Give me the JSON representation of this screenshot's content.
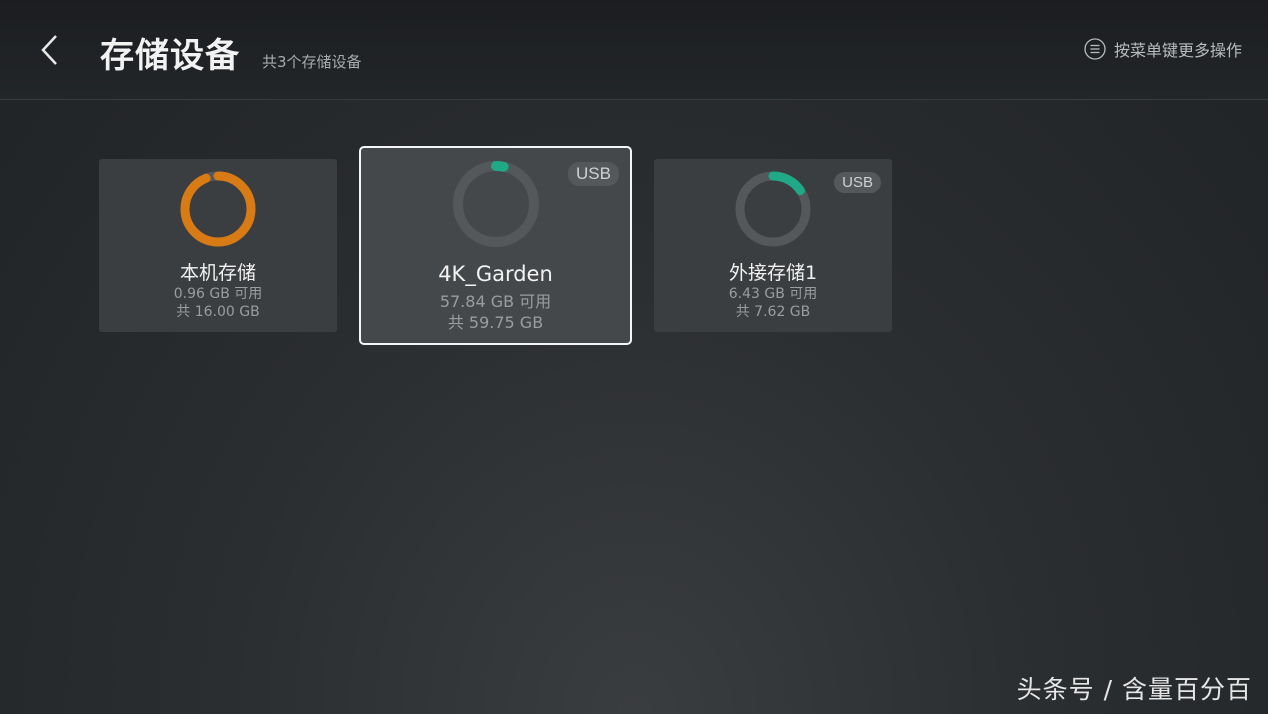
{
  "header": {
    "title": "存储设备",
    "subtitle": "共3个存储设备",
    "menu_hint": "按菜单键更多操作"
  },
  "devices": [
    {
      "name": "本机存储",
      "available": "0.96 GB 可用",
      "total": "共 16.00 GB",
      "badge": "",
      "used_fraction": 0.94,
      "ring_color": "#d97b14",
      "focused": false
    },
    {
      "name": "4K_Garden",
      "available": "57.84 GB 可用",
      "total": "共 59.75 GB",
      "badge": "USB",
      "used_fraction": 0.032,
      "ring_color": "#1fa987",
      "focused": true
    },
    {
      "name": "外接存储1",
      "available": "6.43 GB 可用",
      "total": "共 7.62 GB",
      "badge": "USB",
      "used_fraction": 0.156,
      "ring_color": "#1fa987",
      "focused": false
    }
  ],
  "colors": {
    "ring_track": "#55585b",
    "accent_orange": "#d97b14",
    "accent_green": "#1fa987"
  },
  "watermark": "头条号 / 含量百分百"
}
